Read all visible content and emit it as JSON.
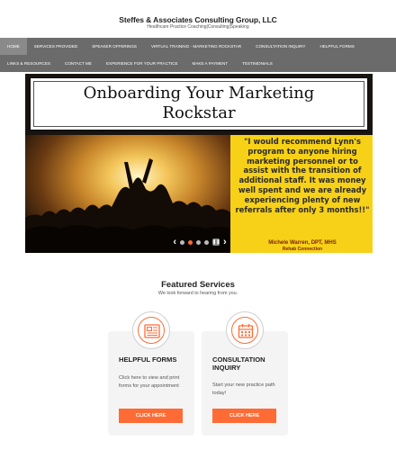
{
  "site": {
    "title": "Steffes & Associates Consulting Group, LLC",
    "tagline": "Healthcare Practice Coaching|Consulting|Speaking"
  },
  "nav": {
    "row1": [
      {
        "label": "HOME",
        "active": true
      },
      {
        "label": "SERVICES PROVIDED"
      },
      {
        "label": "SPEAKER OFFERINGS"
      },
      {
        "label": "VIRTUAL TRAINING - MARKETING ROCKSTAR"
      },
      {
        "label": "CONSULTATION INQUIRY"
      },
      {
        "label": "HELPFUL FORMS"
      }
    ],
    "row2": [
      {
        "label": "LINKS & RESOURCES"
      },
      {
        "label": "CONTACT ME"
      },
      {
        "label": "EXPERIENCE FOR YOUR PRACTICE"
      },
      {
        "label": "MAKE A PAYMENT"
      },
      {
        "label": "TESTIMONIALS"
      }
    ]
  },
  "hero": {
    "title_line1": "Onboarding Your Marketing",
    "title_line2": "Rockstar",
    "quote": "\"I would recommend Lynn's program to anyone hiring marketing personnel or to assist with the transition of additional staff.  It was money well spent and we are already experiencing plenty of new referrals after only 3 months!!\"",
    "attribution": "Michele Warren, DPT, MHS",
    "attribution_org": "Rehab Connection"
  },
  "slider": {
    "prev_symbol": "‹",
    "next_symbol": "›",
    "pause_symbol": "❚❚",
    "dot_count": 4,
    "active_dot": 1
  },
  "featured": {
    "title": "Featured Services",
    "subtitle": "We look forward to hearing from you."
  },
  "cards": [
    {
      "title": "HELPFUL FORMS",
      "text": "Click here to view and print forms for your appointment",
      "button": "CLICK HERE",
      "icon": "newspaper-icon"
    },
    {
      "title": "CONSULTATION INQUIRY",
      "text": "Start your new practice path today!",
      "button": "CLICK HERE",
      "icon": "calendar-icon"
    }
  ],
  "colors": {
    "accent": "#ff6b35",
    "nav_bg": "#6b6b6b",
    "quote_panel": "#f7d117"
  }
}
